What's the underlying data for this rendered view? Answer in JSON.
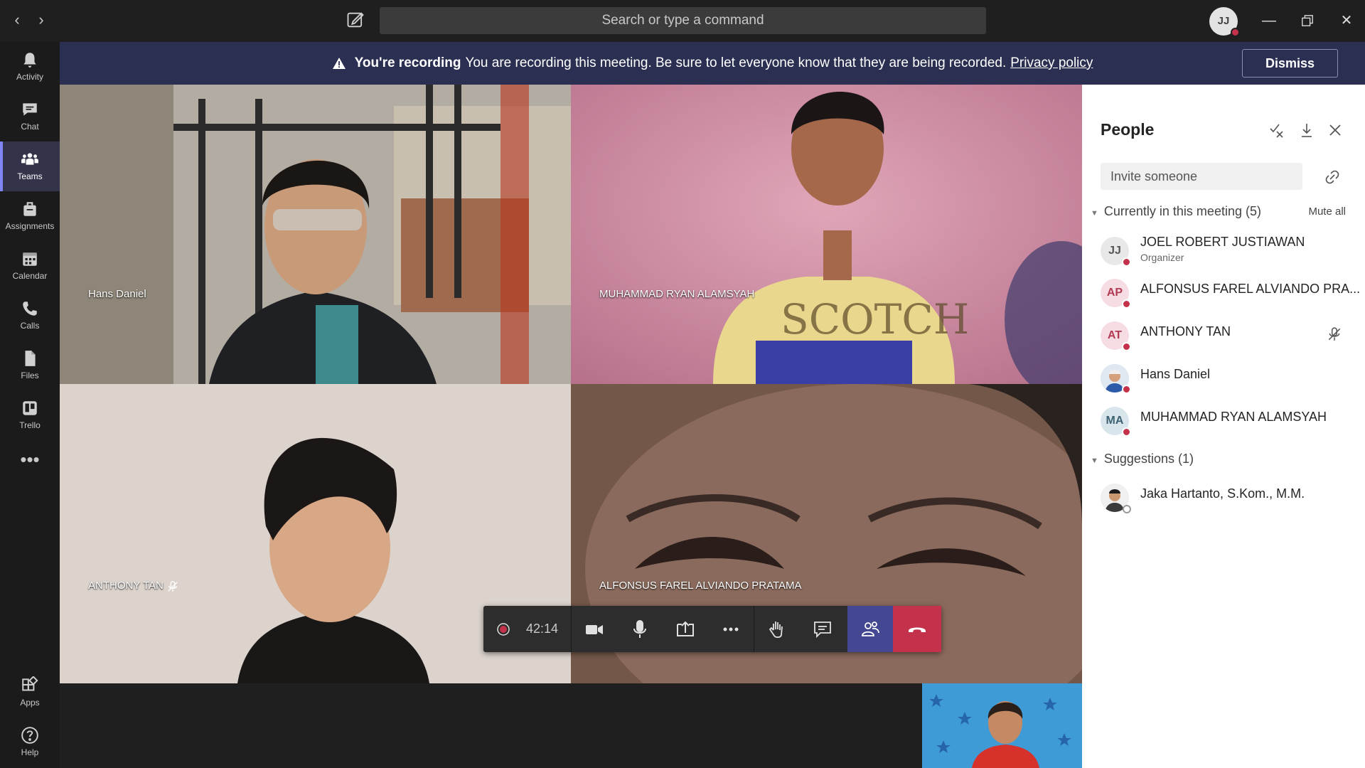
{
  "titlebar": {
    "search_placeholder": "Search or type a command",
    "user_initials": "JJ"
  },
  "banner": {
    "title": "You're recording",
    "message": "You are recording this meeting. Be sure to let everyone know that they are being recorded.",
    "link": "Privacy policy",
    "dismiss": "Dismiss"
  },
  "rail": [
    {
      "label": "Activity",
      "icon": "bell-icon"
    },
    {
      "label": "Chat",
      "icon": "chat-icon"
    },
    {
      "label": "Teams",
      "icon": "teams-icon"
    },
    {
      "label": "Assignments",
      "icon": "assignments-icon"
    },
    {
      "label": "Calendar",
      "icon": "calendar-icon"
    },
    {
      "label": "Calls",
      "icon": "phone-icon"
    },
    {
      "label": "Files",
      "icon": "files-icon"
    },
    {
      "label": "Trello",
      "icon": "trello-icon"
    },
    {
      "label": "Apps",
      "icon": "apps-icon"
    },
    {
      "label": "Help",
      "icon": "help-icon"
    }
  ],
  "videos": [
    {
      "name": "Hans Daniel"
    },
    {
      "name": "MUHAMMAD RYAN ALAMSYAH"
    },
    {
      "name": "ANTHONY TAN"
    },
    {
      "name": "ALFONSUS FAREL ALVIANDO PRATAMA"
    }
  ],
  "controls": {
    "timer": "42:14"
  },
  "people": {
    "title": "People",
    "invite_placeholder": "Invite someone",
    "current_section": "Currently in this meeting (5)",
    "mute_all": "Mute all",
    "participants": [
      {
        "initials": "JJ",
        "name": "JOEL ROBERT JUSTIAWAN",
        "role": "Organizer"
      },
      {
        "initials": "AP",
        "name": "ALFONSUS FAREL ALVIANDO PRA..."
      },
      {
        "initials": "AT",
        "name": "ANTHONY TAN"
      },
      {
        "initials": "",
        "name": "Hans Daniel"
      },
      {
        "initials": "MA",
        "name": "MUHAMMAD RYAN ALAMSYAH"
      }
    ],
    "suggestions_section": "Suggestions (1)",
    "suggestions": [
      {
        "name": "Jaka Hartanto, S.Kom., M.M."
      }
    ]
  },
  "colors": {
    "banner_bg": "#2b2f51",
    "accent": "#7f85f5",
    "hangup": "#c4314b",
    "presence_busy": "#c4314b"
  }
}
